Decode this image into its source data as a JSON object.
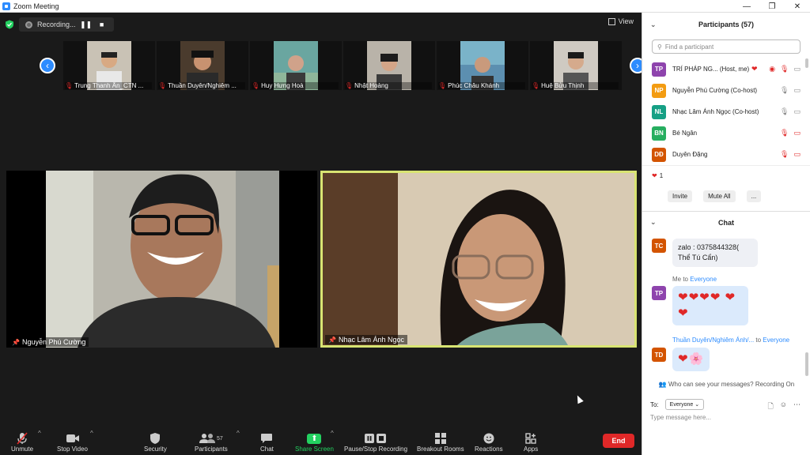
{
  "window": {
    "title": "Zoom Meeting"
  },
  "status": {
    "recording_label": "Recording...",
    "view_label": "View"
  },
  "gallery": {
    "thumbs": [
      {
        "name": "Trung Thanh Ân_CTN ..."
      },
      {
        "name": "Thuần Duyên/Nghiêm ..."
      },
      {
        "name": "Huy Hưng Hoà"
      },
      {
        "name": "Nhật Hoàng"
      },
      {
        "name": "Phúc Châu Khánh"
      },
      {
        "name": "Huệ Bửu Thịnh"
      }
    ]
  },
  "main": {
    "left_name": "Nguyễn Phú Cường",
    "right_name": "Nhạc Lâm Ánh Ngọc"
  },
  "toolbar": {
    "unmute": "Unmute",
    "stop_video": "Stop Video",
    "security": "Security",
    "participants": "Participants",
    "participants_count": "57",
    "chat": "Chat",
    "share_screen": "Share Screen",
    "pause_stop_recording": "Pause/Stop Recording",
    "breakout_rooms": "Breakout Rooms",
    "reactions": "Reactions",
    "apps": "Apps",
    "end": "End"
  },
  "participants_panel": {
    "title": "Participants (57)",
    "search_placeholder": "Find a participant",
    "rows": [
      {
        "initials": "TP",
        "name": "TRÍ PHÁP NG...   (Host, me)",
        "color": "#8e44ad"
      },
      {
        "initials": "NP",
        "name": "Nguyễn Phú Cường (Co-host)",
        "color": "#f39c12"
      },
      {
        "initials": "NL",
        "name": "Nhạc Lâm Ánh Ngọc (Co-host)",
        "color": "#16a085"
      },
      {
        "initials": "BN",
        "name": "Bé Ngân",
        "color": "#27ae60"
      },
      {
        "initials": "DĐ",
        "name": "Duyên Đặng",
        "color": "#d35400"
      }
    ],
    "reaction_count": "1",
    "invite": "Invite",
    "mute_all": "Mute All",
    "more": "..."
  },
  "chat_panel": {
    "title": "Chat",
    "messages": [
      {
        "initials": "TC",
        "color": "#d35400",
        "text": "zalo : 0375844328( Thể Tú Cẩn)"
      },
      {
        "initials": "TP",
        "color": "#8e44ad",
        "meta_prefix": "Me to ",
        "meta_target": "Everyone",
        "text": "❤❤❤❤ ❤❤"
      },
      {
        "initials": "TD",
        "color": "#d35400",
        "meta_prefix": "Thuần Duyên/Nghiêm Ánh/... ",
        "meta_to": "to ",
        "meta_target": "Everyone",
        "text": "❤🌸"
      }
    ],
    "who_can_see": "Who can see your messages? Recording On",
    "to_label": "To:",
    "to_value": "Everyone",
    "input_placeholder": "Type message here..."
  }
}
